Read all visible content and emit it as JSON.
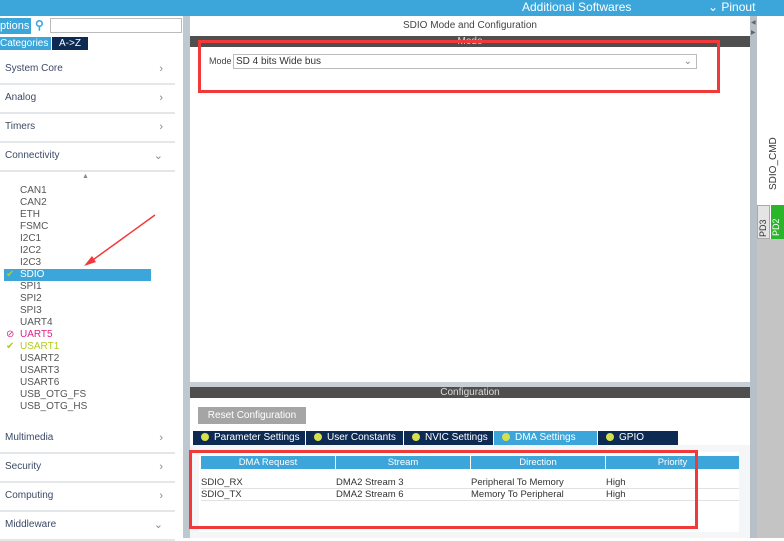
{
  "topbar": {
    "additional": "Additional Softwares",
    "pinout": "Pinout"
  },
  "sidebar": {
    "options_tab": "ptions",
    "search_placeholder": "",
    "categories_tab": "Categories",
    "az_tab": "A->Z",
    "categories_top": [
      {
        "label": "System Core",
        "chevron": "›"
      },
      {
        "label": "Analog",
        "chevron": "›"
      },
      {
        "label": "Timers",
        "chevron": "›"
      },
      {
        "label": "Connectivity",
        "chevron": "⌄"
      }
    ],
    "items": [
      {
        "label": "CAN1",
        "mark": ""
      },
      {
        "label": "CAN2",
        "mark": ""
      },
      {
        "label": "ETH",
        "mark": ""
      },
      {
        "label": "FSMC",
        "mark": ""
      },
      {
        "label": "I2C1",
        "mark": ""
      },
      {
        "label": "I2C2",
        "mark": ""
      },
      {
        "label": "I2C3",
        "mark": ""
      },
      {
        "label": "SDIO",
        "mark": "✔"
      },
      {
        "label": "SPI1",
        "mark": ""
      },
      {
        "label": "SPI2",
        "mark": ""
      },
      {
        "label": "SPI3",
        "mark": ""
      },
      {
        "label": "UART4",
        "mark": ""
      },
      {
        "label": "UART5",
        "mark": "⊘"
      },
      {
        "label": "USART1",
        "mark": "✔"
      },
      {
        "label": "USART2",
        "mark": ""
      },
      {
        "label": "USART3",
        "mark": ""
      },
      {
        "label": "USART6",
        "mark": ""
      },
      {
        "label": "USB_OTG_FS",
        "mark": ""
      },
      {
        "label": "USB_OTG_HS",
        "mark": ""
      }
    ],
    "categories_bottom": [
      {
        "label": "Multimedia",
        "chevron": "›"
      },
      {
        "label": "Security",
        "chevron": "›"
      },
      {
        "label": "Computing",
        "chevron": "›"
      },
      {
        "label": "Middleware",
        "chevron": "⌄"
      }
    ]
  },
  "main": {
    "title": "SDIO Mode and Configuration",
    "mode_bar": "Mode",
    "mode_label": "Mode",
    "mode_value": "SD 4 bits Wide bus",
    "config_bar": "Configuration",
    "reset": "Reset Configuration",
    "tabs": [
      "Parameter Settings",
      "User Constants",
      "NVIC Settings",
      "DMA Settings",
      "GPIO Settings"
    ],
    "table": {
      "headers": [
        "DMA Request",
        "Stream",
        "Direction",
        "Priority"
      ],
      "rows": [
        [
          "SDIO_RX",
          "DMA2 Stream 3",
          "Peripheral To Memory",
          "High"
        ],
        [
          "SDIO_TX",
          "DMA2 Stream 6",
          "Memory To Peripheral",
          "High"
        ]
      ]
    }
  },
  "pinout": {
    "signal": "SDIO_CMD",
    "pins": [
      "PD3",
      "PD2"
    ]
  },
  "colors": {
    "accent": "#3ca6da",
    "navy": "#0d2a52",
    "annotation": "#f2393a",
    "pin_green": "#2ab52a"
  }
}
